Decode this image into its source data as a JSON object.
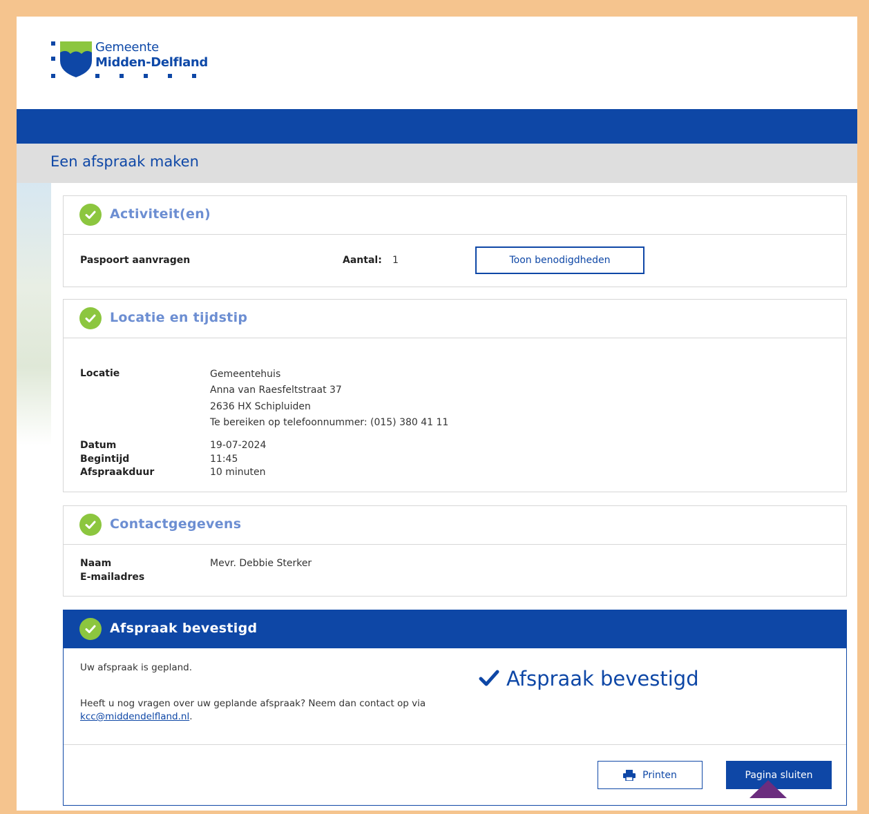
{
  "logo": {
    "line1": "Gemeente",
    "line2": "Midden-Delfland"
  },
  "page_title": "Een afspraak maken",
  "activities": {
    "title": "Activiteit(en)",
    "item_label": "Paspoort aanvragen",
    "count_label": "Aantal:",
    "count_value": "1",
    "show_button": "Toon benodigdheden"
  },
  "location": {
    "title": "Locatie en tijdstip",
    "location_label": "Locatie",
    "location_lines": [
      "Gemeentehuis",
      "Anna van Raesfeltstraat 37",
      "2636 HX Schipluiden",
      "Te bereiken op telefoonnummer: (015) 380 41 11"
    ],
    "date_label": "Datum",
    "date_value": "19-07-2024",
    "start_label": "Begintijd",
    "start_value": "11:45",
    "duration_label": "Afspraakduur",
    "duration_value": "10 minuten"
  },
  "contact": {
    "title": "Contactgegevens",
    "name_label": "Naam",
    "name_value": "Mevr. Debbie Sterker",
    "email_label": "E-mailadres"
  },
  "confirmation": {
    "title": "Afspraak bevestigd",
    "planned_text": "Uw afspraak is gepland.",
    "question_text": "Heeft u nog vragen over uw geplande afspraak? Neem dan contact op via",
    "email_link": "kcc@middendelfland.nl",
    "period": ".",
    "big_text": "Afspraak bevestigd",
    "print_button": "Printen",
    "close_button": "Pagina sluiten"
  },
  "colors": {
    "primary": "#0e47a6",
    "success": "#8cc63f",
    "frame": "#f5c48e",
    "header_gray": "#dedede"
  }
}
